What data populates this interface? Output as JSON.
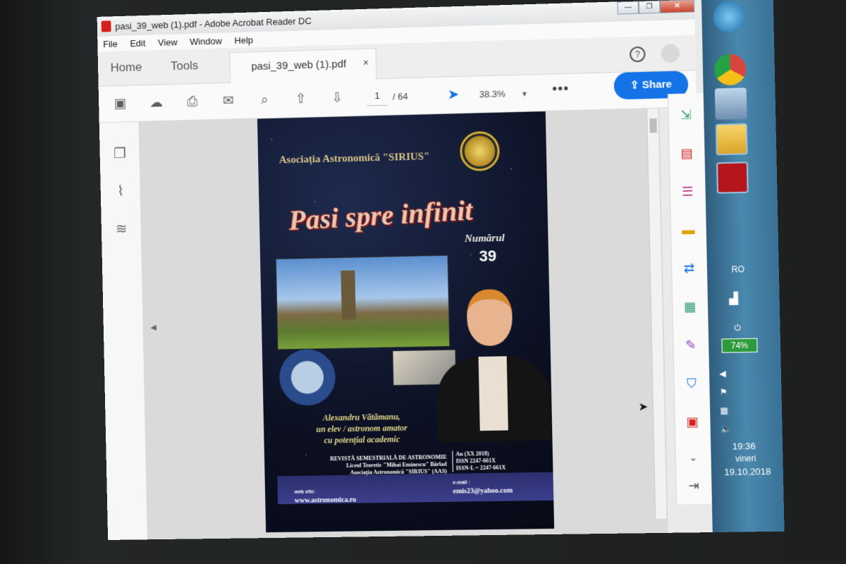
{
  "window": {
    "title": "pasi_39_web (1).pdf - Adobe Acrobat Reader DC",
    "minimize": "—",
    "maximize": "❐",
    "close": "✕"
  },
  "menu": [
    "File",
    "Edit",
    "View",
    "Window",
    "Help"
  ],
  "tabs": {
    "home": "Home",
    "tools": "Tools",
    "document": "pasi_39_web (1).pdf",
    "close_glyph": "×"
  },
  "toolbar": {
    "page_current": "1",
    "page_total": "/ 64",
    "zoom": "38.3%",
    "share_label": "Share",
    "more": "•••",
    "help_glyph": "?"
  },
  "cover": {
    "association": "Asociația Astronomică \"SIRIUS\"",
    "title": "Pasi spre infinit",
    "issue_label": "Numărul",
    "issue_number": "39",
    "caption_lines": [
      "Alexandru Vătămanu,",
      "un elev / astronom amator",
      "cu potențial academic"
    ],
    "info_left": [
      "REVISTĂ SEMESTRIALĂ DE ASTRONOMIE",
      "Liceul Teoretic \"Mihai Eminescu\" Bârlad",
      "Asociația Astronomică \"SIRIUS\" (AAS)"
    ],
    "info_right": [
      "An (XX 2018)",
      "ISSN 2247-661X",
      "ISSN-L = 2247-661X"
    ],
    "web_label": "web site:",
    "web_url": "www.astronomica.ro",
    "mail_label": "e-mail :",
    "mail_addr": "emis23@yahoo.com"
  },
  "taskbar": {
    "language": "RO",
    "battery": "74%",
    "time": "19:36",
    "day": "vineri",
    "date": "19.10.2018"
  },
  "colors": {
    "accent": "#1473e6",
    "pdf_red": "#d3201c",
    "taskbar": "#3a7196"
  }
}
